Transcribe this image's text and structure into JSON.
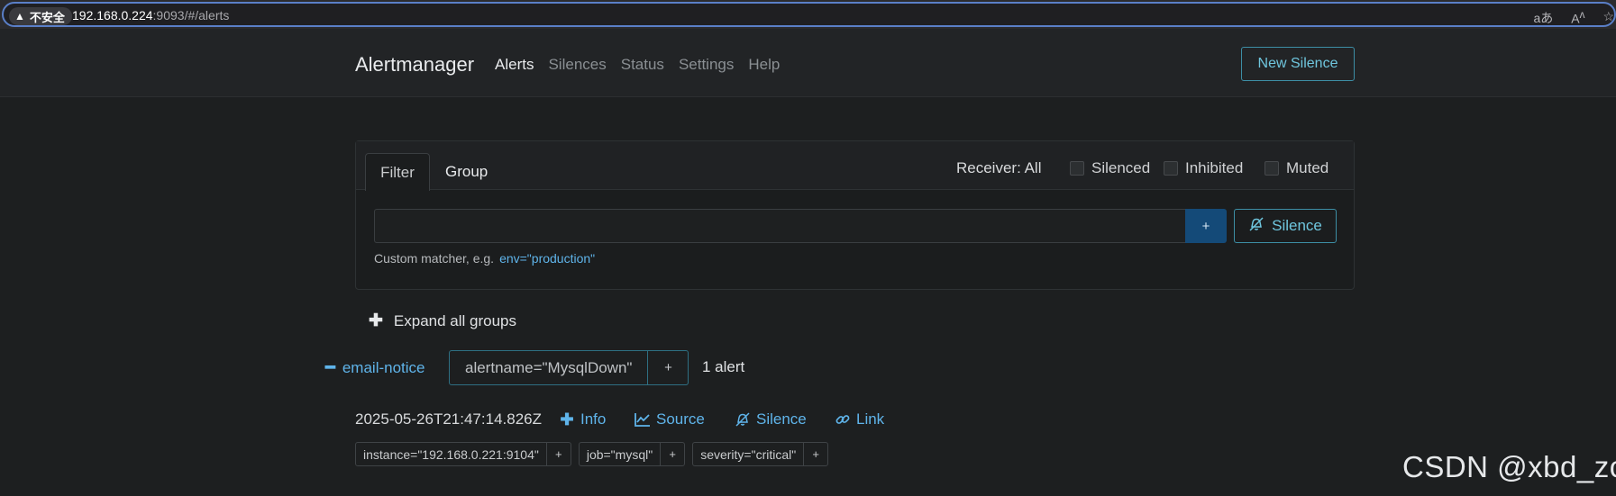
{
  "browser": {
    "insecure_label": "不安全",
    "url_host": "192.168.0.224",
    "url_rest": ":9093/#/alerts",
    "icons": [
      "read-aloud-icon",
      "text-size-icon",
      "favorite-icon"
    ]
  },
  "navbar": {
    "brand": "Alertmanager",
    "links": [
      "Alerts",
      "Silences",
      "Status",
      "Settings",
      "Help"
    ],
    "active": "Alerts",
    "new_silence": "New Silence"
  },
  "filter_card": {
    "tabs": [
      "Filter",
      "Group"
    ],
    "receiver": "Receiver: All",
    "checkboxes": [
      "Silenced",
      "Inhibited",
      "Muted"
    ],
    "input_value": "",
    "add_button": "+",
    "silence_button": "Silence",
    "hint_prefix": "Custom matcher, e.g.",
    "hint_example": "env=\"production\""
  },
  "expand_all": "Expand all groups",
  "group": {
    "receiver": "email-notice",
    "label": "alertname=\"MysqlDown\"",
    "add": "+",
    "count": "1 alert"
  },
  "alert": {
    "time": "2025-05-26T21:47:14.826Z",
    "actions": [
      "Info",
      "Source",
      "Silence",
      "Link"
    ],
    "labels": [
      "instance=\"192.168.0.221:9104\"",
      "job=\"mysql\"",
      "severity=\"critical\""
    ],
    "label_add": "+"
  },
  "watermark": "CSDN @xbd_zc",
  "colors": {
    "accent": "#5fb4ea",
    "outline_btn": "#6fc6de",
    "primary_btn": "#144a78",
    "background": "#1d1f20"
  }
}
